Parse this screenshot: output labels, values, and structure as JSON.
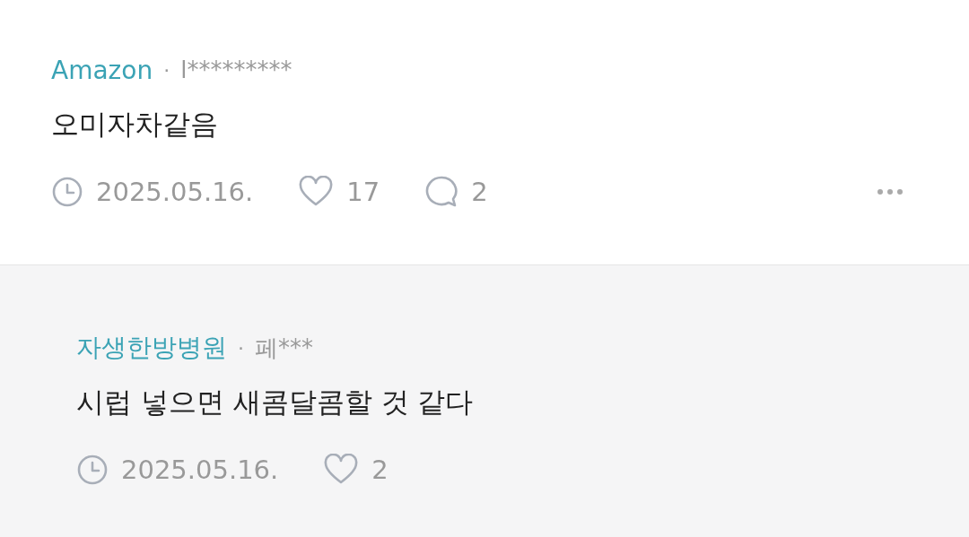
{
  "comments": [
    {
      "kind": "comment",
      "company": "Amazon",
      "separator": "·",
      "author": "l*********",
      "text": "오미자차같음",
      "date": "2025.05.16.",
      "likes": "17",
      "replies": "2"
    },
    {
      "kind": "reply",
      "company": "자생한방병원",
      "separator": "·",
      "author": "페***",
      "text": "시럽 넣으면 새콤달콤할 것 같다",
      "date": "2025.05.16.",
      "likes": "2"
    }
  ]
}
